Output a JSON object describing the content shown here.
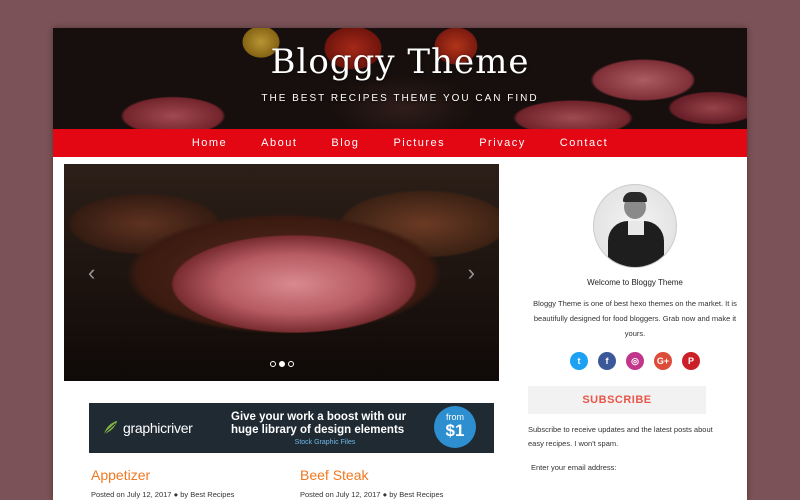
{
  "header": {
    "title": "Bloggy Theme",
    "tagline": "THE BEST RECIPES THEME YOU CAN FIND"
  },
  "nav": {
    "items": [
      {
        "label": "Home"
      },
      {
        "label": "About"
      },
      {
        "label": "Blog"
      },
      {
        "label": "Pictures"
      },
      {
        "label": "Privacy"
      },
      {
        "label": "Contact"
      }
    ],
    "color": "#e30613"
  },
  "slider": {
    "prev_glyph": "‹",
    "next_glyph": "›",
    "dot_count": 3,
    "active_dot": 2
  },
  "ad": {
    "brand": "graphicriver",
    "headline": "Give your work a boost with our huge library of design elements",
    "subline": "Stock Graphic Files",
    "badge_from": "from",
    "badge_price": "$1"
  },
  "posts": [
    {
      "title": "Appetizer",
      "meta_date": "Posted on July 12, 2017",
      "meta_author": "by Best Recipes"
    },
    {
      "title": "Beef Steak",
      "meta_date": "Posted on July 12, 2017",
      "meta_author": "by Best Recipes"
    }
  ],
  "sidebar": {
    "welcome": "Welcome to Bloggy Theme",
    "about": "Bloggy Theme is one of best hexo themes on the market. It is beautifully designed for food bloggers. Grab now and make it yours.",
    "social": [
      {
        "icon": "twitter-icon",
        "glyph": "t",
        "color": "#1da1f2"
      },
      {
        "icon": "facebook-icon",
        "glyph": "f",
        "color": "#3b5998"
      },
      {
        "icon": "instagram-icon",
        "glyph": "◎",
        "color": "#c1358a"
      },
      {
        "icon": "google-plus-icon",
        "glyph": "G+",
        "color": "#dd4b39"
      },
      {
        "icon": "pinterest-icon",
        "glyph": "P",
        "color": "#cb2027"
      }
    ],
    "subscribe_title": "SUBSCRIBE",
    "subscribe_desc": "Subscribe to receive updates and the latest posts about easy recipes. I won't spam.",
    "email_label": "Enter your email address:"
  },
  "colors": {
    "accent": "#f07820",
    "subscribe": "#e8564a",
    "background": "#7b5257"
  }
}
